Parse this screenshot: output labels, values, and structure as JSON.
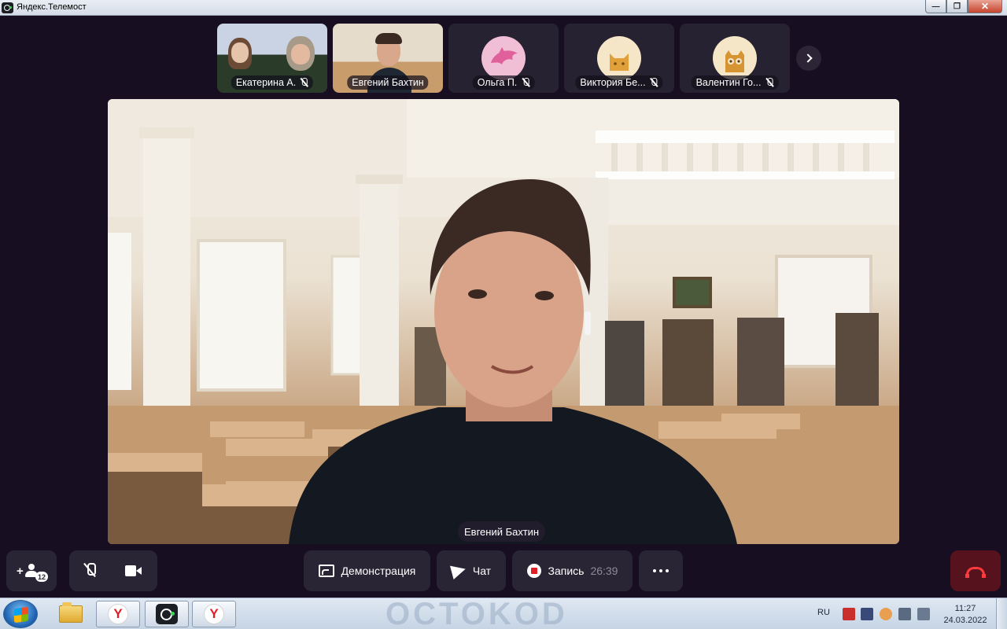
{
  "window": {
    "title": "Яндекс.Телемост",
    "controls": [
      "minimize-icon",
      "maximize-icon",
      "close-icon"
    ]
  },
  "participants": [
    {
      "name": "Екатерина А.",
      "muted": true,
      "type": "video"
    },
    {
      "name": "Евгений Бахтин",
      "muted": false,
      "type": "video"
    },
    {
      "name": "Ольга П.",
      "muted": true,
      "type": "avatar",
      "avatar_icon": "dolphin-icon",
      "avatar_color": "#f0bfd6"
    },
    {
      "name": "Виктория Бе...",
      "muted": true,
      "type": "avatar",
      "avatar_icon": "cat-icon",
      "avatar_color": "#f6e6c8"
    },
    {
      "name": "Валентин Го...",
      "muted": true,
      "type": "avatar",
      "avatar_icon": "owl-icon",
      "avatar_color": "#f6e6c8"
    }
  ],
  "main_video": {
    "speaker_name": "Евгений Бахтин"
  },
  "controls": {
    "invite_badge": "12",
    "screen_share_label": "Демонстрация",
    "chat_label": "Чат",
    "record_label": "Запись",
    "record_timer": "26:39"
  },
  "colors": {
    "background": "#180e22",
    "control_bg": "#2a2535",
    "end_call_bg": "#56121d",
    "end_call_icon": "#ff3b3b",
    "record_red": "#e01e25"
  },
  "taskbar": {
    "watermark": "OCTOKOD",
    "apps": [
      "windows-start-icon",
      "explorer-folder-icon",
      "yandex-browser-icon",
      "telemost-icon",
      "yandex-browser-icon"
    ],
    "language": "RU",
    "time": "11:27",
    "date": "24.03.2022"
  }
}
